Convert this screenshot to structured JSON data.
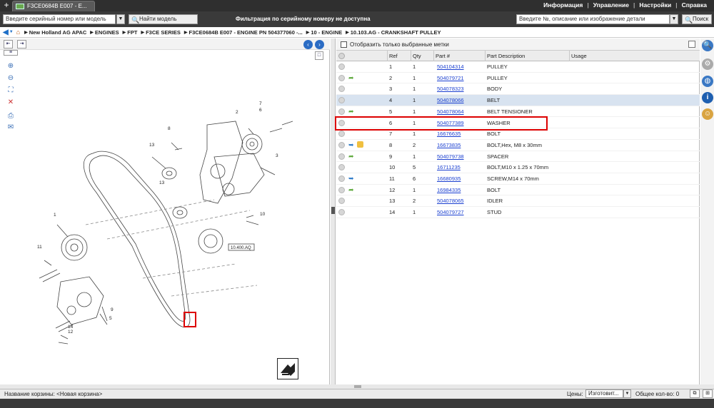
{
  "topbar": {
    "tab_title": "F3CE0684B E007 - E...",
    "nav": [
      "Информация",
      "Управление",
      "Настройки",
      "Справка"
    ]
  },
  "search": {
    "serial_placeholder": "Введите серийный номер или модель",
    "find_model_label": "Найти модель",
    "filter_message": "Фильтрация по серийному номеру не доступна",
    "part_placeholder": "Введите №, описание или изображение детали",
    "search_label": "Поиск"
  },
  "breadcrumb": [
    "New Holland AG APAC",
    "ENGINES",
    "FPT",
    "F3CE SERIES",
    "F3CE0684B E007 - ENGINE PN 504377060 -...",
    "10 - ENGINE",
    "10.103.AG - CRANKSHAFT PULLEY"
  ],
  "drawing": {
    "labels": [
      "7",
      "6",
      "2",
      "8",
      "13",
      "3",
      "1",
      "10",
      "11",
      "10.400.AQ",
      "9",
      "5",
      "14",
      "12",
      "13"
    ],
    "ref_box": "10.400.AQ"
  },
  "parts": {
    "show_selected_label": "Отобразить только выбранные метки",
    "columns": [
      "Ref",
      "Qty",
      "Part #",
      "Part Description",
      "Usage"
    ],
    "rows": [
      {
        "ref": "1",
        "qty": "1",
        "part": "504104314",
        "desc": "PULLEY",
        "icon": ""
      },
      {
        "ref": "2",
        "qty": "1",
        "part": "504079721",
        "desc": "PULLEY",
        "icon": "green"
      },
      {
        "ref": "3",
        "qty": "1",
        "part": "504078323",
        "desc": "BODY",
        "icon": ""
      },
      {
        "ref": "4",
        "qty": "1",
        "part": "504078066",
        "desc": "BELT",
        "icon": "",
        "selected": true
      },
      {
        "ref": "5",
        "qty": "1",
        "part": "504078064",
        "desc": "BELT TENSIONER",
        "icon": "green"
      },
      {
        "ref": "6",
        "qty": "1",
        "part": "504077389",
        "desc": "WASHER",
        "icon": ""
      },
      {
        "ref": "7",
        "qty": "1",
        "part": "16676635",
        "desc": "BOLT",
        "icon": ""
      },
      {
        "ref": "8",
        "qty": "2",
        "part": "16673835",
        "desc": "BOLT,Hex, M8 x 30mm",
        "icon": "blue-yellow"
      },
      {
        "ref": "9",
        "qty": "1",
        "part": "504079738",
        "desc": "SPACER",
        "icon": "green"
      },
      {
        "ref": "10",
        "qty": "5",
        "part": "16711235",
        "desc": "BOLT,M10 x 1.25 x 70mm",
        "icon": ""
      },
      {
        "ref": "11",
        "qty": "6",
        "part": "16680935",
        "desc": "SCREW,M14 x 70mm",
        "icon": "blue"
      },
      {
        "ref": "12",
        "qty": "1",
        "part": "16984335",
        "desc": "BOLT",
        "icon": "green"
      },
      {
        "ref": "13",
        "qty": "2",
        "part": "504078065",
        "desc": "IDLER",
        "icon": ""
      },
      {
        "ref": "14",
        "qty": "1",
        "part": "504079727",
        "desc": "STUD",
        "icon": ""
      }
    ]
  },
  "status": {
    "cart_label": "Название корзины:",
    "cart_name": "<Новая корзина>",
    "prices_label": "Цены:",
    "prices_value": "Изготовит...",
    "total_label": "Общее кол-во:",
    "total_value": "0"
  },
  "colors": {
    "highlight": "#dd0000",
    "link": "#1a3fd0",
    "selected_row": "#d8e3f0"
  }
}
